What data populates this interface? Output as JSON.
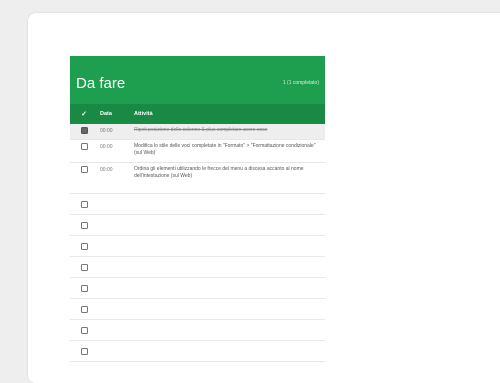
{
  "sheet": {
    "title": "Da fare",
    "summary": "1 (1 completato)",
    "columns": {
      "check": "✓",
      "time": "Data",
      "activity": "Attività"
    },
    "tasks": [
      {
        "checked": true,
        "time": "00:00",
        "text": "Ripeti posizione delle colonne & plus completare avere voce"
      },
      {
        "checked": false,
        "time": "00:00",
        "text": "Modifica lo stile delle voci completate in \"Formato\" > \"Formattazione condizionale\" (sul Web)"
      },
      {
        "checked": false,
        "time": "00:00",
        "text": "Ordina gli elementi utilizzando le frecce del menu a discesa accanto al nome dell'intestazione (sul Web)"
      }
    ],
    "empty_rows": 8
  },
  "colors": {
    "header_green": "#1e9e4f",
    "column_header_green": "#188a43"
  }
}
